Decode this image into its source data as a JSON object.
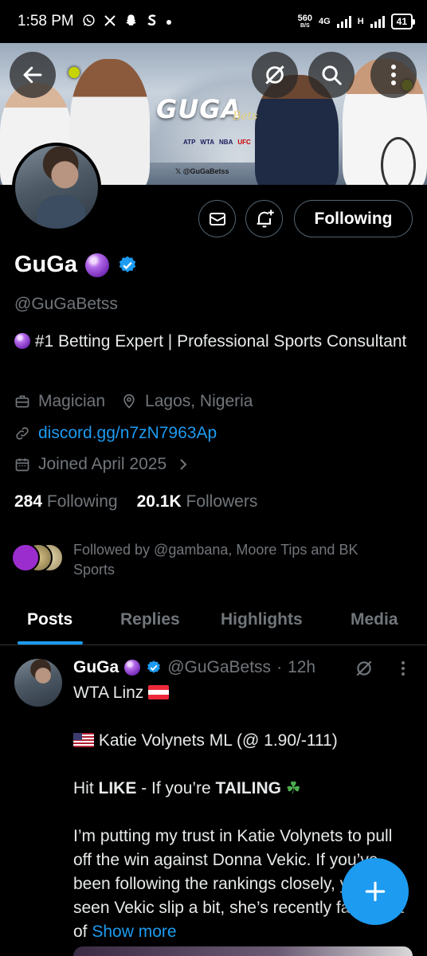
{
  "status_bar": {
    "time": "1:58 PM",
    "icons": [
      "whatsapp-icon",
      "x-icon",
      "snapchat-icon",
      "s-icon",
      "dot-icon"
    ],
    "net_speed": "560",
    "net_unit": "B/S",
    "network": "4G",
    "network2": "H",
    "battery": "41"
  },
  "banner": {
    "logo": "GUGA",
    "logo_sub": "Bets",
    "leagues": [
      "ATP",
      "WTA",
      "NBA",
      "UFC"
    ],
    "handle_tag": "@GuGaBetss"
  },
  "profile": {
    "name": "GuGa",
    "name_emoji": "crystal-ball",
    "verified": true,
    "handle": "@GuGaBetss",
    "bio": "#1 Betting Expert | Professional Sports Consultant",
    "profession": "Magician",
    "location": "Lagos, Nigeria",
    "website": "discord.gg/n7zN7963Ap",
    "joined": "Joined April 2025",
    "following_count": "284",
    "following_label": "Following",
    "followers_count": "20.1K",
    "followers_label": "Followers",
    "followed_by": "Followed by @gambana, Moore Tips and BK Sports",
    "follow_button": "Following"
  },
  "tabs": [
    {
      "label": "Posts",
      "active": true
    },
    {
      "label": "Replies",
      "active": false
    },
    {
      "label": "Highlights",
      "active": false
    },
    {
      "label": "Media",
      "active": false
    }
  ],
  "post": {
    "author": "GuGa",
    "handle": "@GuGaBetss",
    "time": "12h",
    "line1": "WTA Linz",
    "line2": "Katie Volynets ML (@ 1.90/-111)",
    "line3_pre": "Hit ",
    "line3_bold1": "LIKE",
    "line3_mid": " - If you’re ",
    "line3_bold2": "TAILING",
    "line4": "I’m putting my trust in Katie Volynets to pull off the win against Donna Vekic. If you’ve been following the rankings closely, you’ve seen Vekic slip a bit, she’s recently fallen out of",
    "show_more": "Show more"
  },
  "colors": {
    "accent": "#1d9bf0",
    "muted": "#71767b",
    "border": "#2f3336",
    "background": "#000000"
  }
}
